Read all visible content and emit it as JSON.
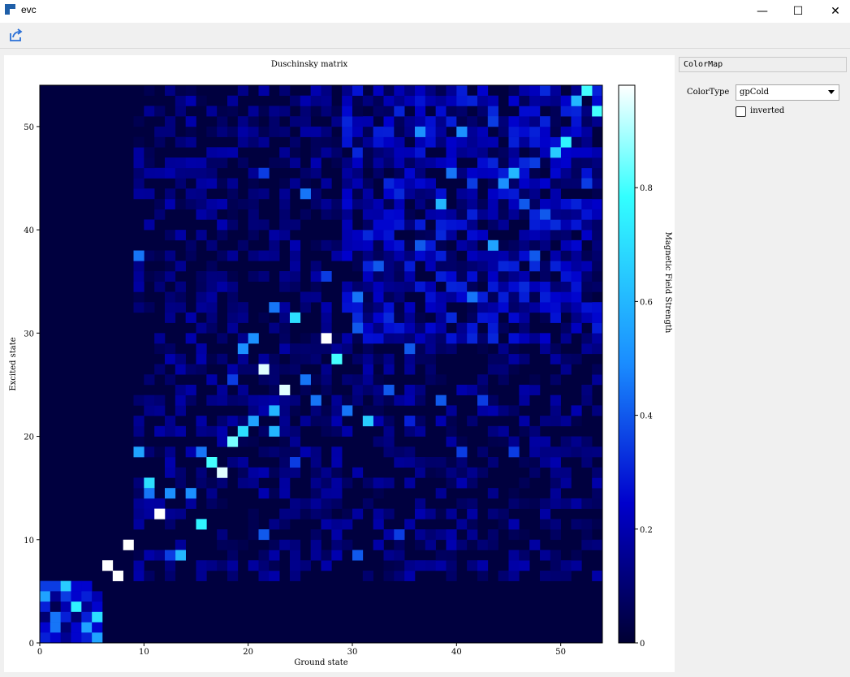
{
  "window": {
    "title": "evc",
    "minimize_glyph": "—",
    "maximize_glyph": "☐",
    "close_glyph": "✕"
  },
  "toolbar": {
    "export_icon": "export-icon"
  },
  "side_panel": {
    "header": "ColorMap",
    "color_type_label": "ColorType",
    "color_type_value": "gpCold",
    "inverted_label": "inverted",
    "inverted_checked": false
  },
  "chart_data": {
    "type": "heatmap",
    "title": "Duschinsky matrix",
    "xlabel": "Ground state",
    "ylabel": "Excited state",
    "colorbar_label": "Magnetic Field Strength",
    "xlim": [
      0,
      54
    ],
    "ylim": [
      0,
      54
    ],
    "x_ticks": [
      0,
      10,
      20,
      30,
      40,
      50
    ],
    "y_ticks": [
      0,
      10,
      20,
      30,
      40,
      50
    ],
    "colorbar_ticks": [
      0,
      0.2,
      0.4,
      0.6,
      0.8
    ],
    "value_range": [
      0,
      0.98
    ],
    "colormap": "gpCold",
    "colormap_stops": [
      "#000033",
      "#0000cc",
      "#1a8cff",
      "#33ffff",
      "#ffffff"
    ],
    "grid_size": 54,
    "bright_cells": [
      {
        "x": 0,
        "y": 5,
        "v": 0.35
      },
      {
        "x": 1,
        "y": 5,
        "v": 0.35
      },
      {
        "x": 2,
        "y": 5,
        "v": 0.65
      },
      {
        "x": 3,
        "y": 5,
        "v": 0.25
      },
      {
        "x": 4,
        "y": 5,
        "v": 0.25
      },
      {
        "x": 0,
        "y": 4,
        "v": 0.55
      },
      {
        "x": 1,
        "y": 4,
        "v": 0.15
      },
      {
        "x": 2,
        "y": 4,
        "v": 0.35
      },
      {
        "x": 3,
        "y": 4,
        "v": 0.25
      },
      {
        "x": 4,
        "y": 4,
        "v": 0.3
      },
      {
        "x": 5,
        "y": 4,
        "v": 0.2
      },
      {
        "x": 0,
        "y": 3,
        "v": 0.3
      },
      {
        "x": 1,
        "y": 3,
        "v": 0.05
      },
      {
        "x": 2,
        "y": 3,
        "v": 0.2
      },
      {
        "x": 3,
        "y": 3,
        "v": 0.75
      },
      {
        "x": 4,
        "y": 3,
        "v": 0.15
      },
      {
        "x": 5,
        "y": 3,
        "v": 0.25
      },
      {
        "x": 0,
        "y": 2,
        "v": 0.1
      },
      {
        "x": 1,
        "y": 2,
        "v": 0.45
      },
      {
        "x": 2,
        "y": 2,
        "v": 0.3
      },
      {
        "x": 3,
        "y": 2,
        "v": 0.1
      },
      {
        "x": 4,
        "y": 2,
        "v": 0.3
      },
      {
        "x": 5,
        "y": 2,
        "v": 0.7
      },
      {
        "x": 0,
        "y": 1,
        "v": 0.25
      },
      {
        "x": 1,
        "y": 1,
        "v": 0.45
      },
      {
        "x": 2,
        "y": 1,
        "v": 0.1
      },
      {
        "x": 3,
        "y": 1,
        "v": 0.25
      },
      {
        "x": 4,
        "y": 1,
        "v": 0.55
      },
      {
        "x": 5,
        "y": 1,
        "v": 0.25
      },
      {
        "x": 0,
        "y": 0,
        "v": 0.3
      },
      {
        "x": 1,
        "y": 0,
        "v": 0.25
      },
      {
        "x": 2,
        "y": 0,
        "v": 0.15
      },
      {
        "x": 3,
        "y": 0,
        "v": 0.25
      },
      {
        "x": 4,
        "y": 0,
        "v": 0.3
      },
      {
        "x": 5,
        "y": 0,
        "v": 0.55
      },
      {
        "x": 6,
        "y": 7,
        "v": 0.98
      },
      {
        "x": 7,
        "y": 6,
        "v": 0.98
      },
      {
        "x": 8,
        "y": 9,
        "v": 0.98
      },
      {
        "x": 11,
        "y": 12,
        "v": 0.98
      },
      {
        "x": 13,
        "y": 8,
        "v": 0.6
      },
      {
        "x": 10,
        "y": 15,
        "v": 0.7
      },
      {
        "x": 15,
        "y": 11,
        "v": 0.75
      },
      {
        "x": 16,
        "y": 17,
        "v": 0.8
      },
      {
        "x": 17,
        "y": 16,
        "v": 0.95
      },
      {
        "x": 18,
        "y": 19,
        "v": 0.85
      },
      {
        "x": 19,
        "y": 20,
        "v": 0.7
      },
      {
        "x": 20,
        "y": 21,
        "v": 0.55
      },
      {
        "x": 21,
        "y": 26,
        "v": 0.95
      },
      {
        "x": 22,
        "y": 20,
        "v": 0.6
      },
      {
        "x": 22,
        "y": 22,
        "v": 0.6
      },
      {
        "x": 23,
        "y": 24,
        "v": 0.95
      },
      {
        "x": 24,
        "y": 31,
        "v": 0.7
      },
      {
        "x": 27,
        "y": 29,
        "v": 0.98
      },
      {
        "x": 28,
        "y": 27,
        "v": 0.8
      },
      {
        "x": 31,
        "y": 21,
        "v": 0.65
      },
      {
        "x": 52,
        "y": 53,
        "v": 0.8
      },
      {
        "x": 51,
        "y": 52,
        "v": 0.6
      },
      {
        "x": 53,
        "y": 51,
        "v": 0.8
      },
      {
        "x": 50,
        "y": 48,
        "v": 0.75
      },
      {
        "x": 49,
        "y": 47,
        "v": 0.65
      },
      {
        "x": 45,
        "y": 45,
        "v": 0.6
      },
      {
        "x": 44,
        "y": 44,
        "v": 0.5
      },
      {
        "x": 40,
        "y": 49,
        "v": 0.5
      },
      {
        "x": 36,
        "y": 49,
        "v": 0.5
      },
      {
        "x": 38,
        "y": 42,
        "v": 0.6
      },
      {
        "x": 43,
        "y": 38,
        "v": 0.55
      },
      {
        "x": 9,
        "y": 18,
        "v": 0.55
      },
      {
        "x": 10,
        "y": 14,
        "v": 0.45
      },
      {
        "x": 12,
        "y": 14,
        "v": 0.5
      },
      {
        "x": 14,
        "y": 14,
        "v": 0.5
      },
      {
        "x": 15,
        "y": 18,
        "v": 0.45
      },
      {
        "x": 20,
        "y": 29,
        "v": 0.5
      },
      {
        "x": 19,
        "y": 28,
        "v": 0.5
      },
      {
        "x": 22,
        "y": 32,
        "v": 0.45
      },
      {
        "x": 25,
        "y": 25,
        "v": 0.45
      },
      {
        "x": 26,
        "y": 23,
        "v": 0.45
      },
      {
        "x": 29,
        "y": 22,
        "v": 0.45
      },
      {
        "x": 30,
        "y": 33,
        "v": 0.45
      },
      {
        "x": 41,
        "y": 33,
        "v": 0.45
      },
      {
        "x": 47,
        "y": 37,
        "v": 0.4
      },
      {
        "x": 9,
        "y": 37,
        "v": 0.45
      },
      {
        "x": 21,
        "y": 45,
        "v": 0.35
      },
      {
        "x": 25,
        "y": 43,
        "v": 0.45
      },
      {
        "x": 32,
        "y": 36,
        "v": 0.4
      },
      {
        "x": 36,
        "y": 38,
        "v": 0.4
      },
      {
        "x": 39,
        "y": 45,
        "v": 0.45
      },
      {
        "x": 46,
        "y": 42,
        "v": 0.4
      },
      {
        "x": 48,
        "y": 41,
        "v": 0.4
      },
      {
        "x": 30,
        "y": 30,
        "v": 0.4
      },
      {
        "x": 35,
        "y": 28,
        "v": 0.4
      },
      {
        "x": 38,
        "y": 23,
        "v": 0.4
      },
      {
        "x": 42,
        "y": 23,
        "v": 0.35
      },
      {
        "x": 33,
        "y": 24,
        "v": 0.4
      },
      {
        "x": 21,
        "y": 10,
        "v": 0.4
      },
      {
        "x": 30,
        "y": 8,
        "v": 0.4
      },
      {
        "x": 34,
        "y": 10,
        "v": 0.35
      },
      {
        "x": 12,
        "y": 8,
        "v": 0.35
      },
      {
        "x": 18,
        "y": 25,
        "v": 0.35
      },
      {
        "x": 24,
        "y": 17,
        "v": 0.35
      },
      {
        "x": 27,
        "y": 35,
        "v": 0.35
      },
      {
        "x": 43,
        "y": 50,
        "v": 0.35
      },
      {
        "x": 41,
        "y": 44,
        "v": 0.35
      },
      {
        "x": 47,
        "y": 46,
        "v": 0.35
      },
      {
        "x": 52,
        "y": 44,
        "v": 0.35
      },
      {
        "x": 40,
        "y": 18,
        "v": 0.35
      },
      {
        "x": 45,
        "y": 18,
        "v": 0.35
      },
      {
        "x": 35,
        "y": 21,
        "v": 0.3
      }
    ]
  }
}
